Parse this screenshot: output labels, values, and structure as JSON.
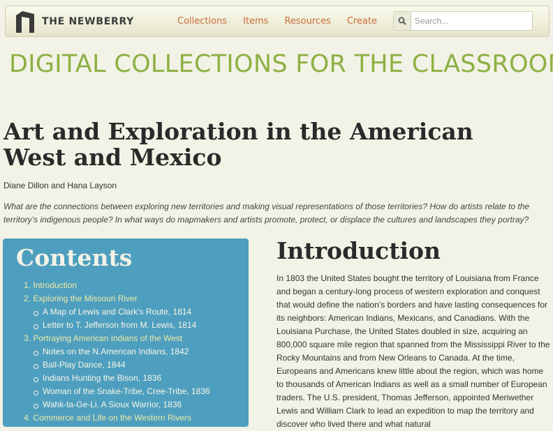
{
  "navbar": {
    "logo_text": "THE NEWBERRY",
    "links": [
      "Collections",
      "Items",
      "Resources",
      "Create"
    ],
    "search_placeholder": "Search..."
  },
  "site_title": "DIGITAL COLLECTIONS FOR THE CLASSROOM",
  "page": {
    "title": "Art and Exploration in the American West and Mexico",
    "authors": "Diane Dillon and Hana Layson",
    "questions": "What are the connections between exploring new territories and making visual representations of those territories? How do artists relate to the territory’s indigenous people? In what ways do mapmakers and artists promote, protect, or displace the cultures and landscapes they portray?"
  },
  "contents": {
    "heading": "Contents",
    "items": [
      {
        "num": "1.",
        "label": "Introduction",
        "subitems": []
      },
      {
        "num": "2.",
        "label": "Exploring the Missouri River",
        "subitems": [
          "A Map of Lewis and Clark’s Route, 1814",
          "Letter to T. Jefferson from M. Lewis, 1814"
        ]
      },
      {
        "num": "3.",
        "label": "Portraying American Indians of the West",
        "subitems": [
          "Notes on the N.American Indians, 1842",
          "Ball-Play Dance, 1844",
          "Indians Hunting the Bison, 1836",
          "Woman of the Snake-Tribe, Cree-Tribe, 1836",
          "Wahk-ta-Ge-Li. A Sioux Warrior, 1836"
        ]
      },
      {
        "num": "4.",
        "label": "Commerce and Life on the Western Rivers",
        "subitems": []
      }
    ]
  },
  "intro": {
    "heading": "Introduction",
    "body": "In 1803 the United States bought the territory of Louisiana from France and began a century-long process of western exploration and conquest that would define the nation’s borders and have lasting consequences for its neighbors: American Indians, Mexicans, and Canadians. With the Louisiana Purchase, the United States doubled in size, acquiring an 800,000 square mile region that spanned from the Mississippi River to the Rocky Mountains and from New Orleans to Canada. At the time, Europeans and Americans knew little about the region, which was home to thousands of American Indians as well as a small number of European traders. The U.S. president, Thomas Jefferson, appointed Meriwether Lewis and William Clark to lead an expedition to map the territory and discover who lived there and what natural"
  },
  "colors": {
    "accent_orange": "#c86b3a",
    "title_green": "#8db043",
    "contents_bg": "#4e9fbf",
    "link_yellow": "#efe9a6"
  },
  "icons": [
    "newberry-logo-icon",
    "search-icon"
  ]
}
